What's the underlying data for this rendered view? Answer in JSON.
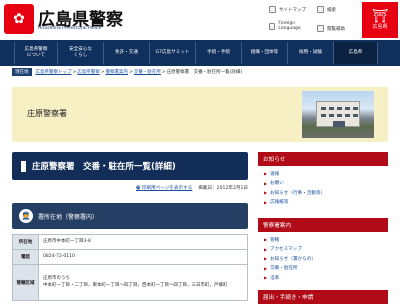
{
  "header": {
    "logo_mark": "✿",
    "title": "広島県警察",
    "subtitle": "Hiroshima Prefectural Police",
    "tools": {
      "sitemap": "サイトマップ",
      "search": "検索",
      "language": "Foreign Language",
      "read_aloud": "閲覧補助"
    },
    "pref_logo": {
      "mark": "⛩",
      "text": "広島県"
    }
  },
  "nav": {
    "items": [
      "広島県警察\nについて",
      "安全安心な\nくらし",
      "免許・交通",
      "G7広島サミット",
      "手続・手続",
      "組織・団体等",
      "採用・試験",
      "広島県"
    ]
  },
  "breadcrumb": {
    "tag": "現在地",
    "items": [
      "広島県警察トップ",
      "広島県警察",
      "警察署案内",
      "交番・駐在所",
      "庄原警察署　交番・駐在所一覧(詳細)"
    ]
  },
  "banner": {
    "title": "庄原警察署"
  },
  "page": {
    "title": "庄原警察署　交番・駐在所一覧(詳細)",
    "print_link": "印刷用ページを表示する",
    "published": "掲載日：2012年2月1日"
  },
  "section": {
    "icon": "👮",
    "title": "署所在地（警察署内）"
  },
  "table": {
    "rows": [
      {
        "label": "所在地",
        "value": "庄原市中本町一丁目3-8"
      },
      {
        "label": "電話",
        "value": "0824-72-0110"
      },
      {
        "label": "管轄区域",
        "value": "庄原市のうち\n中本町一丁目・二丁目，東本町一丁目～四丁目，西本町一丁目～四丁目，三日市町，戸郷町"
      }
    ]
  },
  "sidebar": {
    "sections": [
      {
        "title": "お知らせ",
        "items": [
          "速報",
          "お願い",
          "お知らせ（行事・活動等）",
          "広報紙等"
        ]
      },
      {
        "title": "警察署案内",
        "items": [
          "管轄",
          "アクセスマップ",
          "お知らせ（署からの）",
          "交番・駐在所",
          "沿革"
        ]
      },
      {
        "title": "届出・手続き・申請",
        "items": []
      }
    ]
  }
}
